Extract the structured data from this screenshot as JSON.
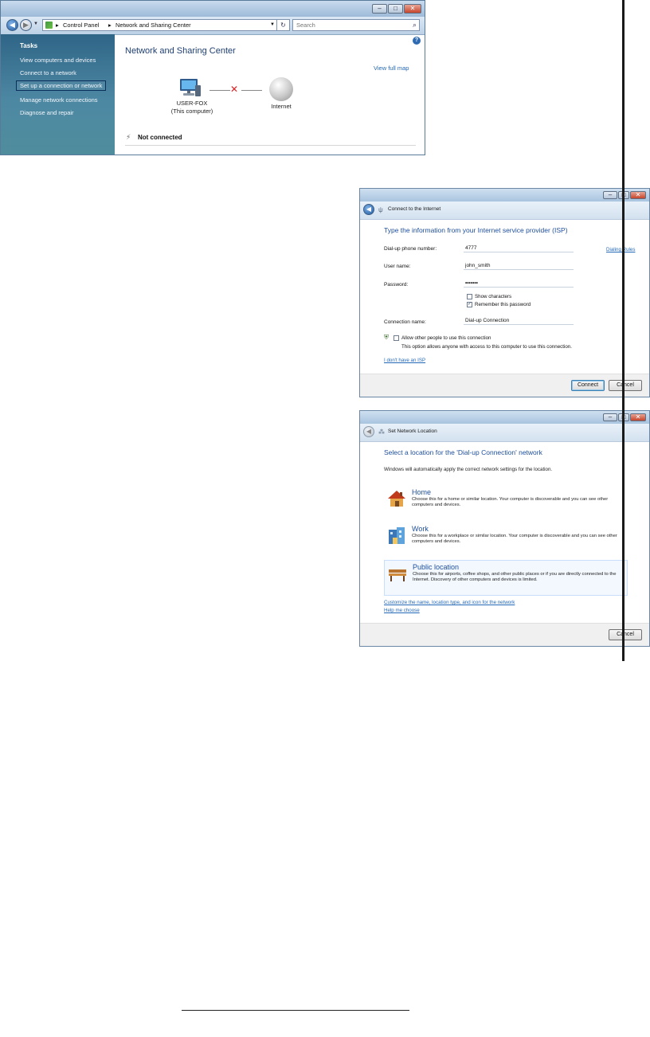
{
  "window1": {
    "breadcrumb": [
      "Control Panel",
      "Network and Sharing Center"
    ],
    "search_placeholder": "Search",
    "sidebar": {
      "heading": "Tasks",
      "items": [
        {
          "label": "View computers and devices"
        },
        {
          "label": "Connect to a network"
        },
        {
          "label": "Set up a connection or network"
        },
        {
          "label": "Manage network connections"
        },
        {
          "label": "Diagnose and repair"
        }
      ]
    },
    "title": "Network and Sharing Center",
    "view_full_map": "View full map",
    "computer_name": "USER-FOX",
    "computer_sub": "(This computer)",
    "internet_label": "Internet",
    "status": "Not connected"
  },
  "dialog_connect": {
    "header_title": "Connect to the Internet",
    "instruction": "Type the information from your Internet service provider (ISP)",
    "fields": {
      "phone_label": "Dial-up phone number:",
      "phone_value": "4777",
      "username_label": "User name:",
      "username_value": "john_smith",
      "password_label": "Password:",
      "password_value": "•••••••",
      "connection_label": "Connection name:",
      "connection_value": "Dial-up Connection"
    },
    "dialing_rules": "Dialing Rules",
    "show_characters": "Show characters",
    "remember_password": "Remember this password",
    "allow_others": "Allow other people to use this connection",
    "allow_others_desc": "This option allows anyone with access to this computer to use this connection.",
    "no_isp_link": "I don't have an ISP",
    "connect_button": "Connect",
    "cancel_button": "Cancel"
  },
  "dialog_location": {
    "header_title": "Set Network Location",
    "instruction": "Select a location for the 'Dial-up Connection' network",
    "subtitle": "Windows will automatically apply the correct network settings for the location.",
    "options": [
      {
        "title": "Home",
        "desc": "Choose this for a home or similar location. Your computer is discoverable and you can see other computers and devices."
      },
      {
        "title": "Work",
        "desc": "Choose this for a workplace or similar location. Your computer is discoverable and you can see other computers and devices."
      },
      {
        "title": "Public location",
        "desc": "Choose this for airports, coffee shops, and other public places or if you are directly connected to the Internet. Discovery of other computers and devices is limited."
      }
    ],
    "customize_link": "Customize the name, location type, and icon for the network",
    "help_link": "Help me choose",
    "cancel_button": "Cancel"
  }
}
